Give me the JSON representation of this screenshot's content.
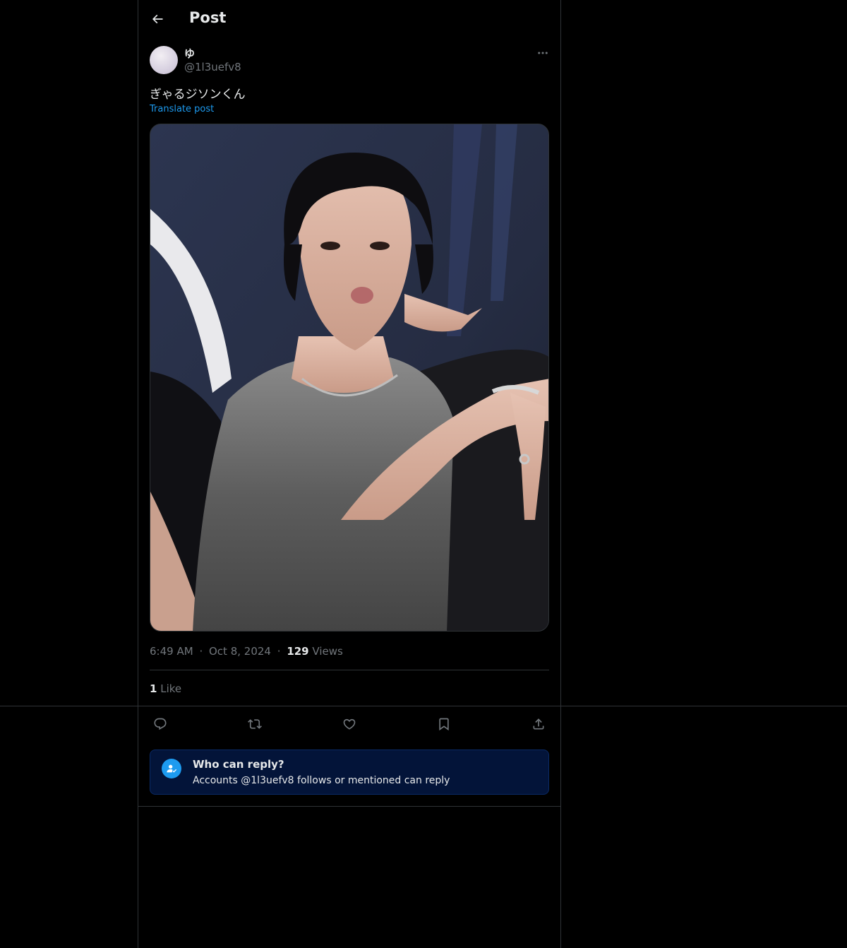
{
  "header": {
    "title": "Post"
  },
  "author": {
    "display_name": "ゆ",
    "handle": "@1l3uefv8"
  },
  "post": {
    "text": "ぎゃるジソンくん",
    "translate_label": "Translate post",
    "media_alt": "Photo of a person with dark hair in a sleeveless metallic knit top posing in front of a dark blue backdrop"
  },
  "meta": {
    "time": "6:49 AM",
    "separator": "·",
    "date": "Oct 8, 2024",
    "views_count": "129",
    "views_label": "Views"
  },
  "likes": {
    "count": "1",
    "label": "Like"
  },
  "actions": {
    "icons": [
      "reply-icon",
      "repost-icon",
      "like-icon",
      "bookmark-icon",
      "share-icon"
    ]
  },
  "reply_restriction": {
    "title": "Who can reply?",
    "subtitle": "Accounts @1l3uefv8 follows or mentioned can reply"
  },
  "colors": {
    "background": "#000000",
    "border": "#2f3336",
    "text_primary": "#e7e9ea",
    "text_secondary": "#71767b",
    "accent": "#1d9bf0",
    "reply_box_bg": "#031439"
  }
}
